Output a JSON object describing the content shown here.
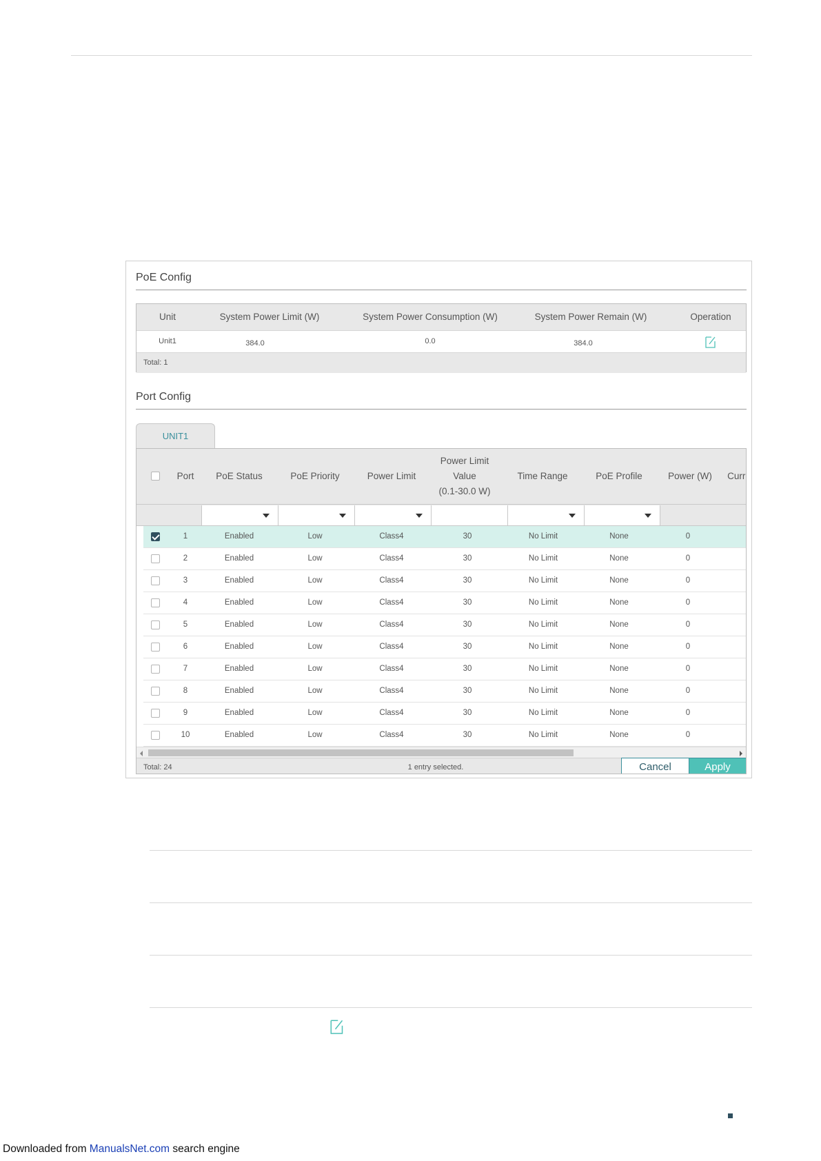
{
  "poe_config": {
    "title": "PoE Config",
    "columns": [
      "Unit",
      "System Power Limit (W)",
      "System Power Consumption (W)",
      "System Power Remain (W)",
      "Operation"
    ],
    "row": {
      "unit": "Unit1",
      "limit": "384.0",
      "consumption": "0.0",
      "remain": "384.0"
    },
    "total": "Total: 1"
  },
  "port_config": {
    "title": "Port Config",
    "tab": "UNIT1",
    "columns": {
      "port": "Port",
      "status": "PoE Status",
      "priority": "PoE Priority",
      "limit": "Power Limit",
      "value_l1": "Power Limit",
      "value_l2": "Value",
      "value_l3": "(0.1-30.0 W)",
      "time_range": "Time Range",
      "profile": "PoE Profile",
      "power": "Power (W)",
      "current": "Curre"
    },
    "rows": [
      {
        "port": "1",
        "status": "Enabled",
        "priority": "Low",
        "limit": "Class4",
        "value": "30",
        "time": "No Limit",
        "profile": "None",
        "power": "0",
        "checked": true
      },
      {
        "port": "2",
        "status": "Enabled",
        "priority": "Low",
        "limit": "Class4",
        "value": "30",
        "time": "No Limit",
        "profile": "None",
        "power": "0",
        "checked": false
      },
      {
        "port": "3",
        "status": "Enabled",
        "priority": "Low",
        "limit": "Class4",
        "value": "30",
        "time": "No Limit",
        "profile": "None",
        "power": "0",
        "checked": false
      },
      {
        "port": "4",
        "status": "Enabled",
        "priority": "Low",
        "limit": "Class4",
        "value": "30",
        "time": "No Limit",
        "profile": "None",
        "power": "0",
        "checked": false
      },
      {
        "port": "5",
        "status": "Enabled",
        "priority": "Low",
        "limit": "Class4",
        "value": "30",
        "time": "No Limit",
        "profile": "None",
        "power": "0",
        "checked": false
      },
      {
        "port": "6",
        "status": "Enabled",
        "priority": "Low",
        "limit": "Class4",
        "value": "30",
        "time": "No Limit",
        "profile": "None",
        "power": "0",
        "checked": false
      },
      {
        "port": "7",
        "status": "Enabled",
        "priority": "Low",
        "limit": "Class4",
        "value": "30",
        "time": "No Limit",
        "profile": "None",
        "power": "0",
        "checked": false
      },
      {
        "port": "8",
        "status": "Enabled",
        "priority": "Low",
        "limit": "Class4",
        "value": "30",
        "time": "No Limit",
        "profile": "None",
        "power": "0",
        "checked": false
      },
      {
        "port": "9",
        "status": "Enabled",
        "priority": "Low",
        "limit": "Class4",
        "value": "30",
        "time": "No Limit",
        "profile": "None",
        "power": "0",
        "checked": false
      },
      {
        "port": "10",
        "status": "Enabled",
        "priority": "Low",
        "limit": "Class4",
        "value": "30",
        "time": "No Limit",
        "profile": "None",
        "power": "0",
        "checked": false
      }
    ],
    "total": "Total: 24",
    "selection": "1 entry selected.",
    "cancel_label": "Cancel",
    "apply_label": "Apply"
  },
  "footer": {
    "prefix": "Downloaded from ",
    "link": "ManualsNet.com",
    "suffix": " search engine"
  },
  "colors": {
    "accent": "#4fc1b7",
    "selected_row": "#d6f1ec",
    "link": "#1a3fb5"
  }
}
